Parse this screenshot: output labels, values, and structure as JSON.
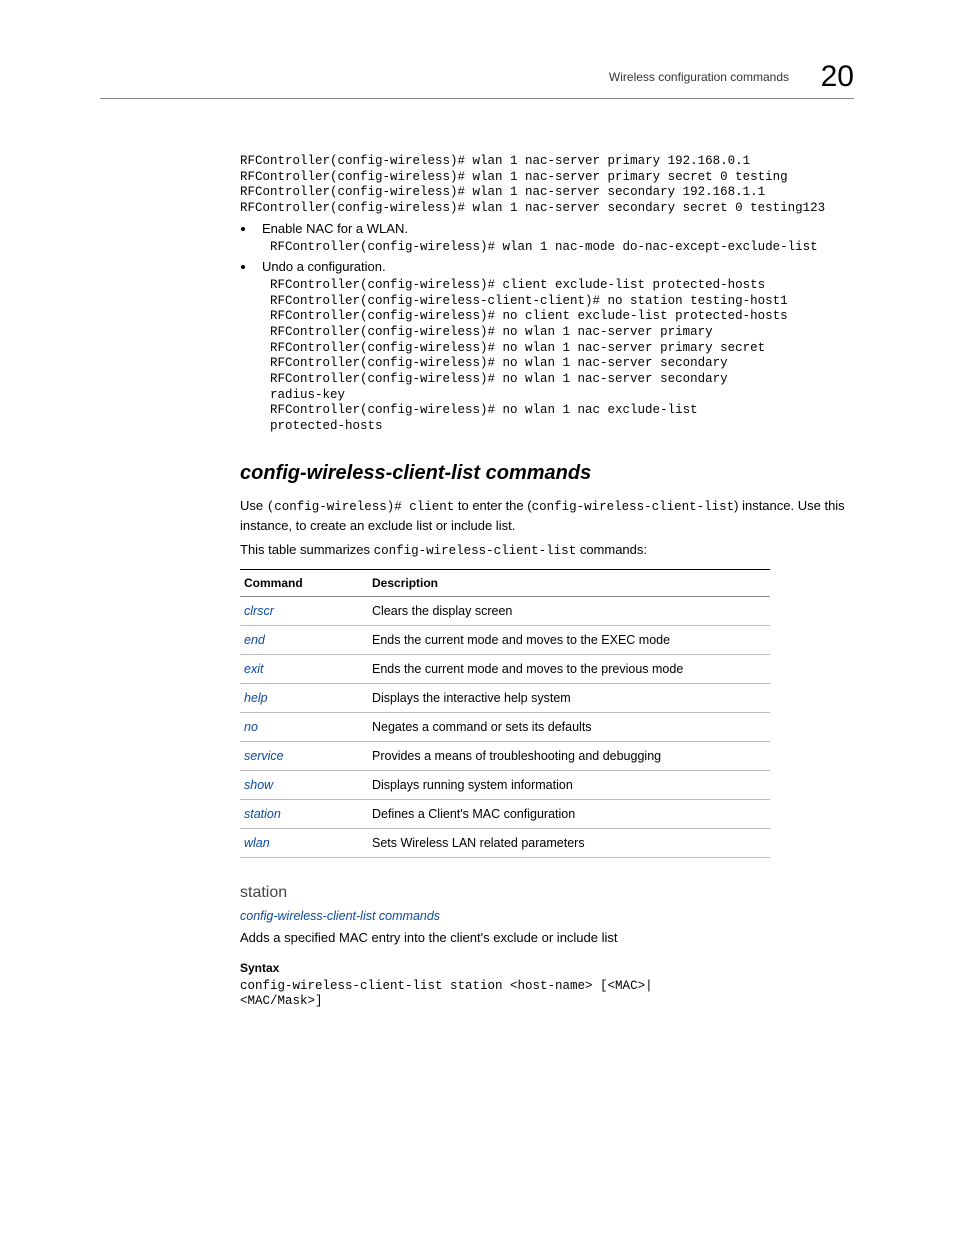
{
  "header": {
    "title": "Wireless configuration commands",
    "chapter": "20"
  },
  "code_block_1": "RFController(config-wireless)# wlan 1 nac-server primary 192.168.0.1\nRFController(config-wireless)# wlan 1 nac-server primary secret 0 testing\nRFController(config-wireless)# wlan 1 nac-server secondary 192.168.1.1\nRFController(config-wireless)# wlan 1 nac-server secondary secret 0 testing123",
  "bullet1": "Enable NAC for a WLAN.",
  "code_block_2": "RFController(config-wireless)# wlan 1 nac-mode do-nac-except-exclude-list",
  "bullet2": "Undo a configuration.",
  "code_block_3": "RFController(config-wireless)# client exclude-list protected-hosts\nRFController(config-wireless-client-client)# no station testing-host1\nRFController(config-wireless)# no client exclude-list protected-hosts\nRFController(config-wireless)# no wlan 1 nac-server primary\nRFController(config-wireless)# no wlan 1 nac-server primary secret\nRFController(config-wireless)# no wlan 1 nac-server secondary\nRFController(config-wireless)# no wlan 1 nac-server secondary\nradius-key\nRFController(config-wireless)# no wlan 1 nac exclude-list\nprotected-hosts",
  "section_heading": "config-wireless-client-list commands",
  "intro": {
    "p1a": "Use ",
    "p1b": "(config-wireless)# client",
    "p1c": " to enter the (",
    "p1d": "config-wireless-client-list",
    "p1e": ") instance. Use this instance, to create an exclude list or include list."
  },
  "summary": {
    "pre": "This table summarizes ",
    "code": "config-wireless-client-list",
    "post": " commands:"
  },
  "table": {
    "h1": "Command",
    "h2": "Description",
    "rows": [
      {
        "cmd": "clrscr",
        "desc": "Clears the display screen"
      },
      {
        "cmd": "end",
        "desc": "Ends the current mode and moves to the EXEC mode"
      },
      {
        "cmd": "exit",
        "desc": "Ends the current mode and moves to the previous mode"
      },
      {
        "cmd": "help",
        "desc": "Displays the interactive help system"
      },
      {
        "cmd": "no",
        "desc": "Negates a command or sets its defaults"
      },
      {
        "cmd": "service",
        "desc": "Provides a means of troubleshooting and debugging"
      },
      {
        "cmd": "show",
        "desc": "Displays running system information"
      },
      {
        "cmd": "station",
        "desc": "Defines a Client's MAC configuration"
      },
      {
        "cmd": "wlan",
        "desc": "Sets Wireless LAN related parameters"
      }
    ]
  },
  "sub_heading": "station",
  "sub_ref": "config-wireless-client-list commands",
  "sub_desc": "Adds a specified MAC entry into the client's exclude or include list",
  "syntax_label": "Syntax",
  "syntax_code": "config-wireless-client-list station <host-name> [<MAC>|\n<MAC/Mask>]"
}
